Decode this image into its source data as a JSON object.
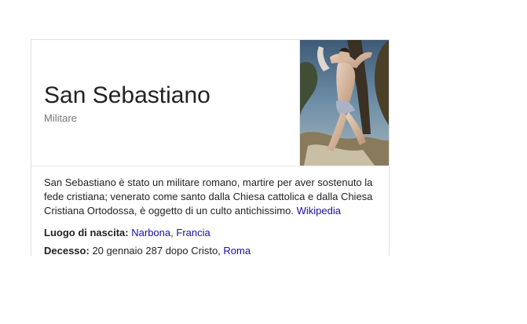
{
  "entity": {
    "title": "San Sebastiano",
    "subtitle": "Militare",
    "image_alt": "San Sebastiano"
  },
  "description": {
    "text": "San Sebastiano è stato un militare romano, martire per aver sostenuto la fede cristiana; venerato come santo dalla Chiesa cattolica e dalla Chiesa Cristiana Ortodossa, è oggetto di un culto antichissimo.",
    "source_link": "Wikipedia"
  },
  "facts": {
    "birthplace": {
      "label": "Luogo di nascita:",
      "value_1": "Narbona",
      "separator": ",",
      "value_2": "Francia"
    },
    "death": {
      "label": "Decesso:",
      "text": "20 gennaio 287 dopo Cristo,",
      "place": "Roma"
    }
  },
  "colors": {
    "link": "#1a0dab",
    "subtitle": "#777777",
    "border": "#e0e0e0"
  }
}
